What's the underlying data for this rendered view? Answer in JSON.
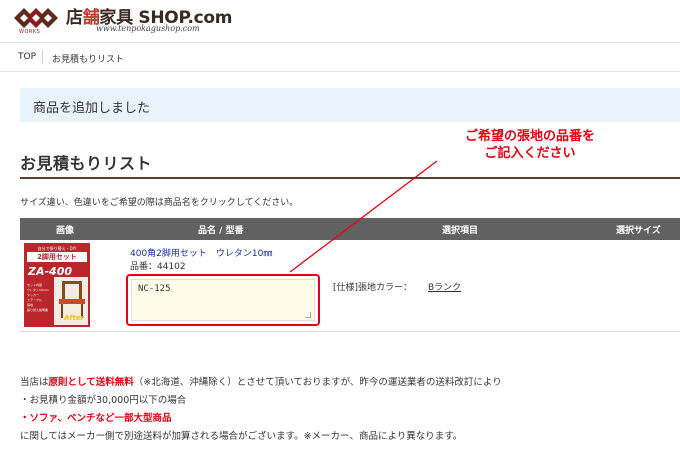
{
  "header": {
    "logo_works": "WORKS",
    "site_name_a": "店",
    "site_name_b": "舗",
    "site_name_c": "家具",
    "site_name_d": " SHOP.com",
    "site_url": "www.tenpokagushop.com"
  },
  "breadcrumb": {
    "top": "TOP",
    "current": "お見積もりリスト"
  },
  "notice": "商品を追加しました",
  "annotation": {
    "line1": "ご希望の張地の品番を",
    "line2": "ご記入ください"
  },
  "page_title": "お見積もりリスト",
  "instructions": "サイズ違い、色違いをご希望の際は商品名をクリックしてください。",
  "table": {
    "headers": [
      "画像",
      "品名 / 型番",
      "選択項目",
      "選択サイズ"
    ],
    "row": {
      "image": {
        "top_text": "自分で張り替え・DIY",
        "band_text": "2脚用セット",
        "model": "ZA-400",
        "after": "After",
        "list": [
          "セット内容",
          "ウレタン10mm",
          "タッカー",
          "ステープル",
          "張地",
          "張り替え説明書"
        ]
      },
      "name": "400角2脚用セット　ウレタン10㎜",
      "code": "品番：44102",
      "remarks_value": "NC-125",
      "option_label": "[仕様]張地カラー：",
      "option_value": "Bランク"
    }
  },
  "shipping_note": {
    "line1_a": "当店は",
    "line1_b": "原則として送料無料",
    "line1_c": "（※北海道、沖縄除く）とさせて頂いておりますが、昨今の運送業者の送料改訂により",
    "line2": "・お見積り金額が30,000円以下の場合",
    "line3": "・ソファ、ベンチなど一部大型商品",
    "line4": "に関してはメーカー側で別途送料が加算される場合がございます。※メーカー、商品により異なります。"
  },
  "colors": {
    "accent_red": "#e60012",
    "notice_bg": "#e8f3fb",
    "table_head_bg": "#616161",
    "title_rule": "#5a3d2c",
    "link_blue": "#1a2fa0"
  },
  "icons": [
    "logo-mark-icon",
    "resize-grip-icon"
  ]
}
